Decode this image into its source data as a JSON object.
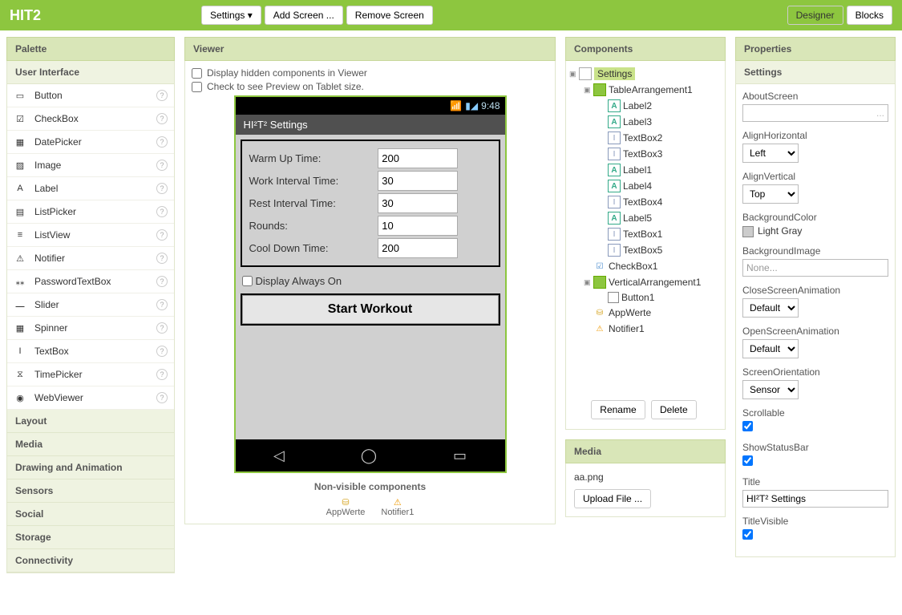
{
  "header": {
    "project": "HIT2",
    "settings_btn": "Settings",
    "add_screen": "Add Screen ...",
    "remove_screen": "Remove Screen",
    "designer": "Designer",
    "blocks": "Blocks"
  },
  "palette": {
    "title": "Palette",
    "section": "User Interface",
    "items": [
      {
        "label": "Button"
      },
      {
        "label": "CheckBox"
      },
      {
        "label": "DatePicker"
      },
      {
        "label": "Image"
      },
      {
        "label": "Label"
      },
      {
        "label": "ListPicker"
      },
      {
        "label": "ListView"
      },
      {
        "label": "Notifier"
      },
      {
        "label": "PasswordTextBox"
      },
      {
        "label": "Slider"
      },
      {
        "label": "Spinner"
      },
      {
        "label": "TextBox"
      },
      {
        "label": "TimePicker"
      },
      {
        "label": "WebViewer"
      }
    ],
    "categories": [
      "Layout",
      "Media",
      "Drawing and Animation",
      "Sensors",
      "Social",
      "Storage",
      "Connectivity"
    ]
  },
  "viewer": {
    "title": "Viewer",
    "opt_hidden": "Display hidden components in Viewer",
    "opt_tablet": "Check to see Preview on Tablet size.",
    "phone": {
      "time": "9:48",
      "app_title": "HI²T² Settings",
      "rows": [
        {
          "label": "Warm Up Time:",
          "value": "200"
        },
        {
          "label": "Work Interval Time:",
          "value": "30"
        },
        {
          "label": "Rest Interval Time:",
          "value": "30"
        },
        {
          "label": "Rounds:",
          "value": "10"
        },
        {
          "label": "Cool Down Time:",
          "value": "200"
        }
      ],
      "checkbox": "Display Always On",
      "button": "Start Workout"
    },
    "nonvisible_header": "Non-visible components",
    "nonvisible": [
      "AppWerte",
      "Notifier1"
    ]
  },
  "components": {
    "title": "Components",
    "tree": {
      "root": "Settings",
      "n1": "TableArrangement1",
      "leaves1": [
        "Label2",
        "Label3",
        "TextBox2",
        "TextBox3",
        "Label1",
        "Label4",
        "TextBox4",
        "Label5",
        "TextBox1",
        "TextBox5"
      ],
      "n2": "CheckBox1",
      "n3": "VerticalArrangement1",
      "n3c": "Button1",
      "n4": "AppWerte",
      "n5": "Notifier1"
    },
    "rename": "Rename",
    "delete": "Delete"
  },
  "media": {
    "title": "Media",
    "file": "aa.png",
    "upload": "Upload File ..."
  },
  "properties": {
    "title": "Properties",
    "component": "Settings",
    "props": {
      "about_label": "AboutScreen",
      "about_value": "",
      "alignh_label": "AlignHorizontal",
      "alignh_value": "Left",
      "alignv_label": "AlignVertical",
      "alignv_value": "Top",
      "bgcolor_label": "BackgroundColor",
      "bgcolor_value": "Light Gray",
      "bgimage_label": "BackgroundImage",
      "bgimage_value": "None...",
      "close_label": "CloseScreenAnimation",
      "close_value": "Default",
      "open_label": "OpenScreenAnimation",
      "open_value": "Default",
      "orient_label": "ScreenOrientation",
      "orient_value": "Sensor",
      "scroll_label": "Scrollable",
      "status_label": "ShowStatusBar",
      "title_label": "Title",
      "title_value": "HI²T² Settings",
      "titlevis_label": "TitleVisible"
    }
  }
}
